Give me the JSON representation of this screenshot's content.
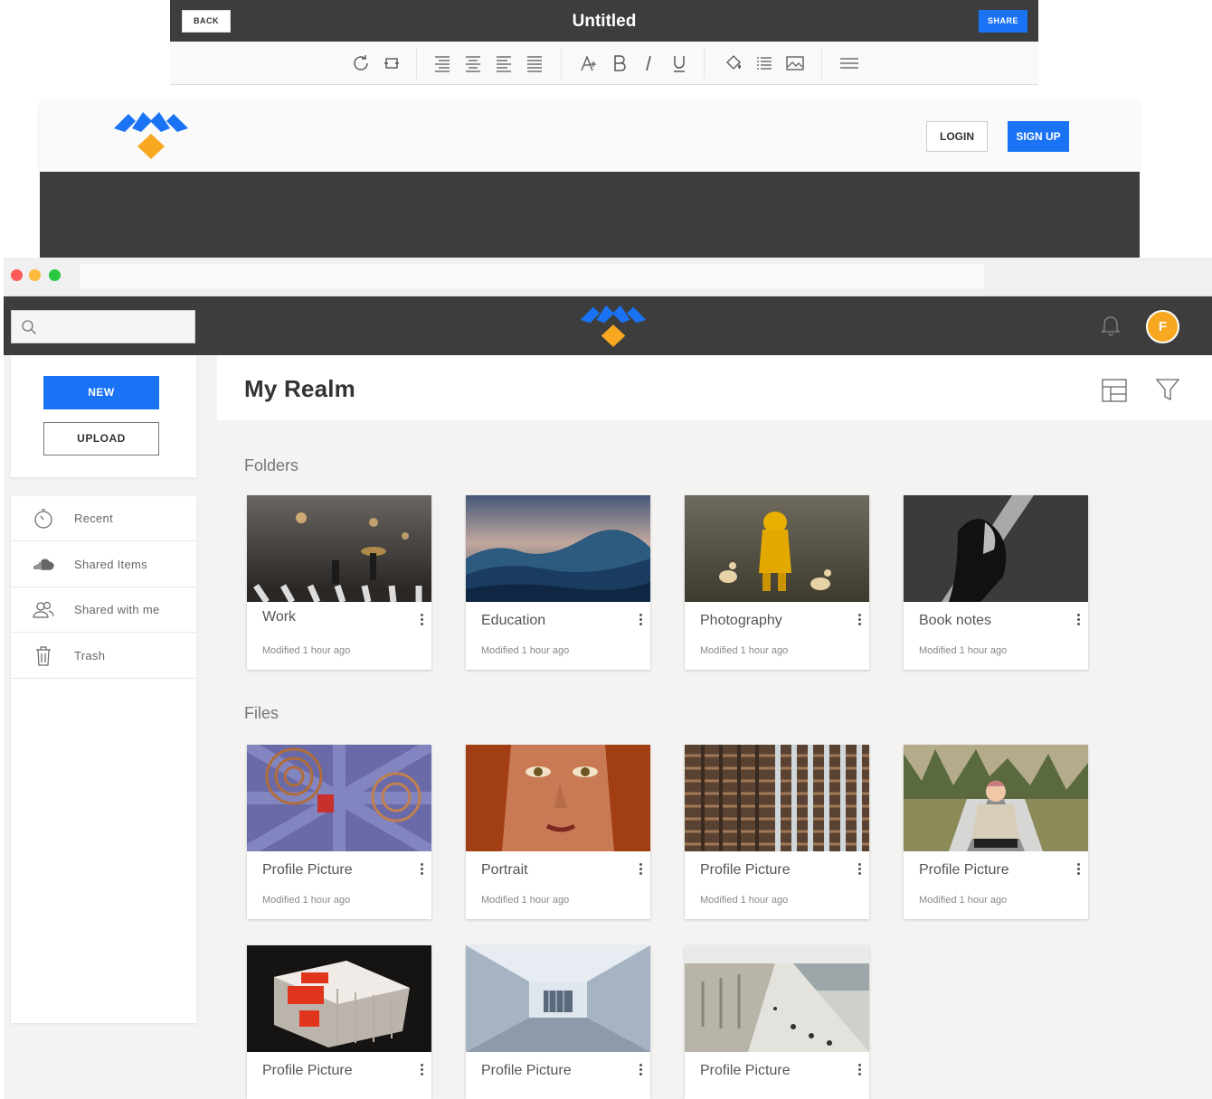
{
  "editor": {
    "back_label": "BACK",
    "title": "Untitled",
    "share_label": "SHARE",
    "toolbar_icons": [
      "refresh-icon",
      "replace-icon",
      "align-right-icon",
      "align-center-icon",
      "align-left-icon",
      "align-justify-icon",
      "font-size-icon",
      "bold-icon",
      "italic-icon",
      "underline-icon",
      "fill-color-icon",
      "list-icon",
      "image-icon",
      "menu-icon"
    ]
  },
  "landing": {
    "login_label": "LOGIN",
    "signup_label": "SIGN UP"
  },
  "app": {
    "search_placeholder": "",
    "avatar_initial": "F",
    "sidebar": {
      "new_label": "NEW",
      "upload_label": "UPLOAD",
      "items": [
        {
          "label": "Recent",
          "icon": "clock-icon"
        },
        {
          "label": "Shared Items",
          "icon": "cloud-icon"
        },
        {
          "label": "Shared with me",
          "icon": "users-icon"
        },
        {
          "label": "Trash",
          "icon": "trash-icon"
        }
      ]
    },
    "page_title": "My Realm",
    "folders_title": "Folders",
    "files_title": "Files",
    "folders": [
      {
        "name": "Work",
        "modified": "Modified 1 hour ago"
      },
      {
        "name": "Education",
        "modified": "Modified 1 hour ago"
      },
      {
        "name": "Photography",
        "modified": "Modified 1 hour ago"
      },
      {
        "name": "Book notes",
        "modified": "Modified 1 hour ago"
      }
    ],
    "files": [
      {
        "name": "Profile Picture",
        "modified": "Modified 1 hour ago"
      },
      {
        "name": "Portrait",
        "modified": "Modified 1 hour ago"
      },
      {
        "name": "Profile Picture",
        "modified": "Modified 1 hour ago"
      },
      {
        "name": "Profile Picture",
        "modified": "Modified 1 hour ago"
      },
      {
        "name": "Profile Picture"
      },
      {
        "name": "Profile Picture"
      },
      {
        "name": "Profile Picture"
      }
    ]
  },
  "colors": {
    "accent": "#1a73f5",
    "dark_bar": "#3d3d3d",
    "logo_orange": "#f8a820",
    "background": "#f4f3f1"
  }
}
